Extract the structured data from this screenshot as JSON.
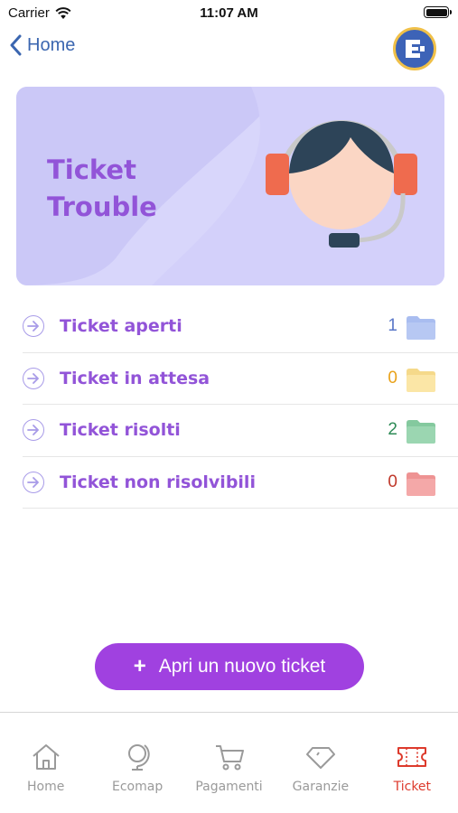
{
  "status": {
    "carrier": "Carrier",
    "time": "11:07 AM"
  },
  "nav": {
    "back_label": "Home"
  },
  "hero": {
    "title_line1": "Ticket",
    "title_line2": "Trouble"
  },
  "tickets": [
    {
      "label": "Ticket aperti",
      "count": "1",
      "count_color": "#5a77c8",
      "folder_color": "#a9bdf0"
    },
    {
      "label": "Ticket in attesa",
      "count": "0",
      "count_color": "#e9a21a",
      "folder_color": "#fbe6a6"
    },
    {
      "label": "Ticket risolti",
      "count": "2",
      "count_color": "#2e8b57",
      "folder_color": "#9bd6b1"
    },
    {
      "label": "Ticket non risolvibili",
      "count": "0",
      "count_color": "#c0392b",
      "folder_color": "#f4a8a8"
    }
  ],
  "cta": {
    "label": "Apri un nuovo ticket",
    "icon": "plus-icon"
  },
  "tabs": [
    {
      "label": "Home",
      "icon": "home-icon"
    },
    {
      "label": "Ecomap",
      "icon": "globe-icon"
    },
    {
      "label": "Pagamenti",
      "icon": "cart-icon"
    },
    {
      "label": "Garanzie",
      "icon": "diamond-icon"
    },
    {
      "label": "Ticket",
      "icon": "ticket-icon",
      "active": true
    }
  ],
  "colors": {
    "accent": "#a041e0",
    "title_purple": "#9254d8",
    "active_tab": "#dd3a2c",
    "hero_bg": "#d8d6fb"
  }
}
